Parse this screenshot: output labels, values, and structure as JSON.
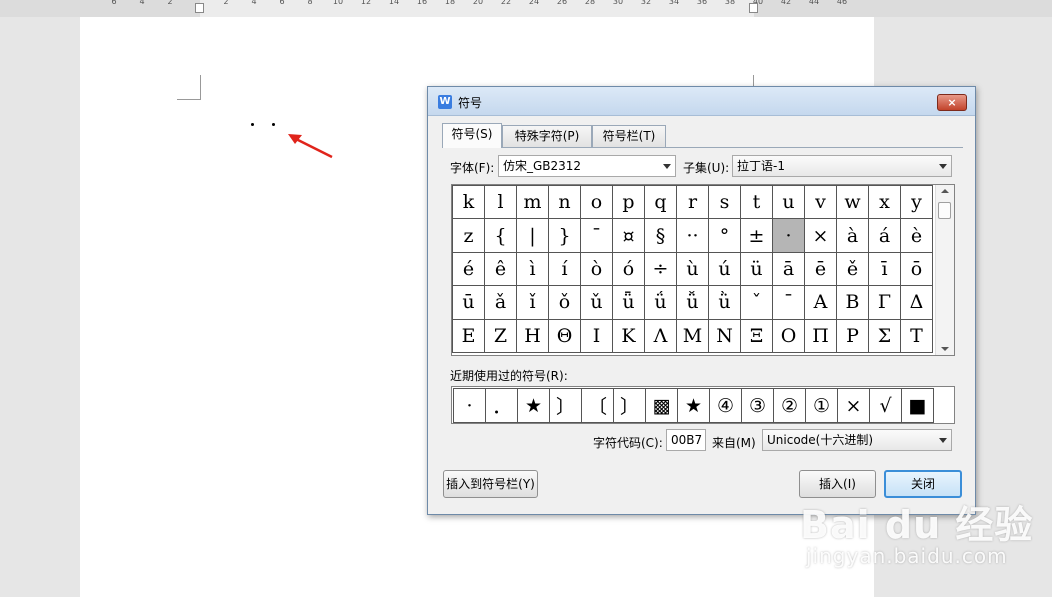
{
  "ruler": {
    "numbers": [
      "6",
      "4",
      "2",
      "2",
      "4",
      "6",
      "8",
      "10",
      "12",
      "14",
      "16",
      "18",
      "20",
      "22",
      "24",
      "26",
      "28",
      "30",
      "32",
      "34",
      "36",
      "38",
      "40",
      "42",
      "44",
      "46"
    ]
  },
  "dialog": {
    "title": "符号",
    "close_label": "×",
    "tabs": [
      {
        "label": "符号(S)",
        "active": true
      },
      {
        "label": "特殊字符(P)",
        "active": false
      },
      {
        "label": "符号栏(T)",
        "active": false
      }
    ],
    "font_label": "字体(F):",
    "font_value": "仿宋_GB2312",
    "subset_label": "子集(U):",
    "subset_value": "拉丁语-1",
    "symbols": [
      [
        "k",
        "l",
        "m",
        "n",
        "o",
        "p",
        "q",
        "r",
        "s",
        "t",
        "u",
        "v",
        "w",
        "x",
        "y"
      ],
      [
        "z",
        "{",
        "|",
        "}",
        "¯",
        "¤",
        "§",
        "··",
        "°",
        "±",
        "·",
        "×",
        "à",
        "á",
        "è"
      ],
      [
        "é",
        "ê",
        "ì",
        "í",
        "ò",
        "ó",
        "÷",
        "ù",
        "ú",
        "ü",
        "ā",
        "ē",
        "ě",
        "ī",
        "ō"
      ],
      [
        "ū",
        "ǎ",
        "ǐ",
        "ǒ",
        "ǔ",
        "ǖ",
        "ǘ",
        "ǚ",
        "ǜ",
        "ˇ",
        "ˉ",
        "Α",
        "Β",
        "Γ",
        "Δ"
      ],
      [
        "Ε",
        "Ζ",
        "Η",
        "Θ",
        "Ι",
        "Κ",
        "Λ",
        "Μ",
        "Ν",
        "Ξ",
        "Ο",
        "Π",
        "Ρ",
        "Σ",
        "Τ"
      ]
    ],
    "selected_symbol": {
      "row": 1,
      "col": 10
    },
    "recent_label": "近期使用过的符号(R):",
    "recent_symbols": [
      "·",
      "．",
      "★",
      "〕",
      "〔",
      "〕",
      "▩",
      "★",
      "④",
      "③",
      "②",
      "①",
      "×",
      "√",
      "■"
    ],
    "char_code_label": "字符代码(C):",
    "char_code_value": "00B7",
    "from_label": "来自(M)",
    "from_value": "Unicode(十六进制)",
    "insert_to_bar_label": "插入到符号栏(Y)",
    "insert_label": "插入(I)",
    "close_button_label": "关闭"
  },
  "watermark": {
    "main": "Bai du 经验",
    "sub": "jingyan.baidu.com"
  },
  "colors": {
    "arrow": "#e0241b",
    "primary_button_border": "#3b8ed8",
    "titlebar": "#c5d8ee"
  }
}
